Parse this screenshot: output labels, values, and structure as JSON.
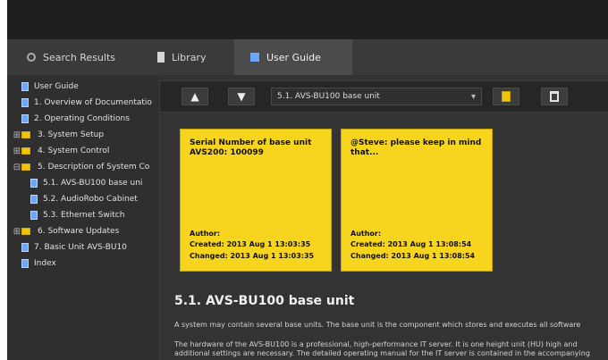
{
  "tabs": [
    {
      "label": "Search Results"
    },
    {
      "label": "Library"
    },
    {
      "label": "User Guide"
    }
  ],
  "sidebar": {
    "items": [
      {
        "label": "User Guide",
        "type": "doc",
        "indent": 0,
        "expander": ""
      },
      {
        "label": "1. Overview of Documentatio",
        "type": "doc",
        "indent": 0,
        "expander": ""
      },
      {
        "label": "2. Operating Conditions",
        "type": "doc",
        "indent": 0,
        "expander": ""
      },
      {
        "label": "3. System Setup",
        "type": "folder",
        "indent": 0,
        "expander": "⊞"
      },
      {
        "label": "4. System Control",
        "type": "folder",
        "indent": 0,
        "expander": "⊞"
      },
      {
        "label": "5. Description of System Co",
        "type": "folder",
        "indent": 0,
        "expander": "⊟"
      },
      {
        "label": "5.1. AVS-BU100 base uni",
        "type": "doc",
        "indent": 1,
        "expander": ""
      },
      {
        "label": "5.2. AudioRobo Cabinet",
        "type": "doc",
        "indent": 1,
        "expander": ""
      },
      {
        "label": "5.3. Ethernet Switch",
        "type": "doc",
        "indent": 1,
        "expander": ""
      },
      {
        "label": "6. Software Updates",
        "type": "folder",
        "indent": 0,
        "expander": "⊞"
      },
      {
        "label": "7. Basic Unit AVS-BU10",
        "type": "doc",
        "indent": 0,
        "expander": ""
      },
      {
        "label": "Index",
        "type": "doc",
        "indent": 0,
        "expander": ""
      }
    ]
  },
  "toolbar": {
    "up_label": "▲",
    "down_label": "▼",
    "selected_value": "5.1. AVS-BU100 base unit",
    "bookmark_icon": "bookmark-icon",
    "delete_icon": "trash-icon"
  },
  "notes": [
    {
      "title": "Serial Number of base unit AVS200: 100099",
      "author_label": "Author:",
      "created": "Created: 2013 Aug 1 13:03:35",
      "changed": "Changed: 2013 Aug 1 13:03:35"
    },
    {
      "title": "@Steve: please keep in mind that...",
      "author_label": "Author:",
      "created": "Created: 2013 Aug 1 13:08:54",
      "changed": "Changed: 2013 Aug 1 13:08:54"
    }
  ],
  "main": {
    "heading": "5.1. AVS-BU100 base unit",
    "para1": "A system may contain several base units. The base unit is the component which stores and executes all software",
    "para2": "The hardware of the AVS-BU100 is a professional, high-performance IT server. It is one height unit (HU) high and",
    "para3": "additional settings are necessary. The detailed operating manual for the IT server is contained in the accompanying"
  },
  "colors": {
    "note_yellow": "#f7d51e",
    "accent_blue": "#6aa7ff",
    "folder_yellow": "#f1c40f"
  }
}
